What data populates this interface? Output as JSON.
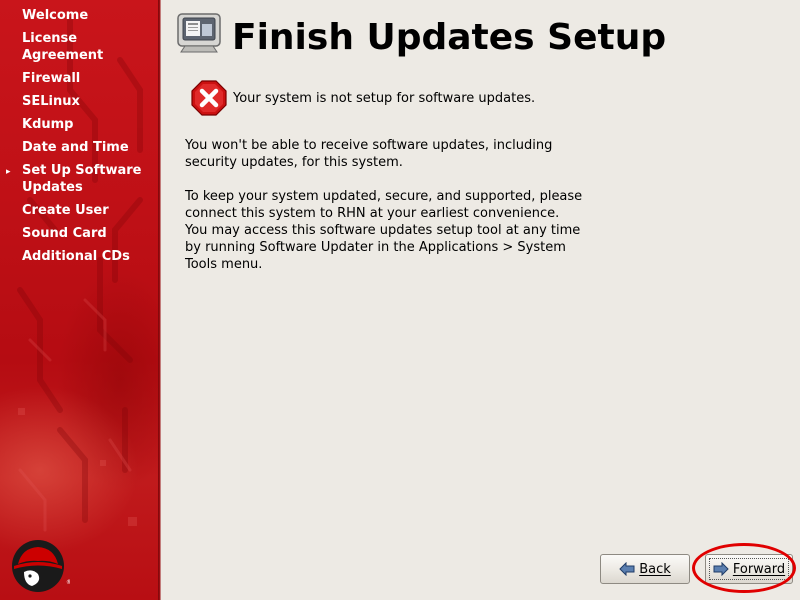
{
  "sidebar": {
    "items": [
      {
        "label": "Welcome",
        "current": false
      },
      {
        "label": "License\nAgreement",
        "current": false
      },
      {
        "label": "Firewall",
        "current": false
      },
      {
        "label": "SELinux",
        "current": false
      },
      {
        "label": "Kdump",
        "current": false
      },
      {
        "label": "Date and Time",
        "current": false
      },
      {
        "label": "Set Up Software\nUpdates",
        "current": true
      },
      {
        "label": "Create User",
        "current": false
      },
      {
        "label": "Sound Card",
        "current": false
      },
      {
        "label": "Additional CDs",
        "current": false
      }
    ],
    "current_marker": "▸",
    "logo_icon": "redhat-shadowman-logo",
    "background_color": "#c0141a"
  },
  "header": {
    "title": "Finish Updates Setup",
    "icon": "computer-screen-icon"
  },
  "main": {
    "status": {
      "icon": "error-x-icon",
      "text": "Your system is not setup for software updates."
    },
    "paragraphs": [
      "You won't be able to receive software updates, including security updates, for this system.",
      "To keep your system updated, secure, and supported, please connect this system to RHN at your earliest convenience. You may access this software updates setup tool at any time by running Software Updater in the Applications > System Tools menu."
    ]
  },
  "buttons": {
    "back_label": "Back",
    "back_icon": "arrow-left-icon",
    "forward_label": "Forward",
    "forward_icon": "arrow-right-icon"
  },
  "annotation": {
    "highlight_color": "#e00000"
  }
}
